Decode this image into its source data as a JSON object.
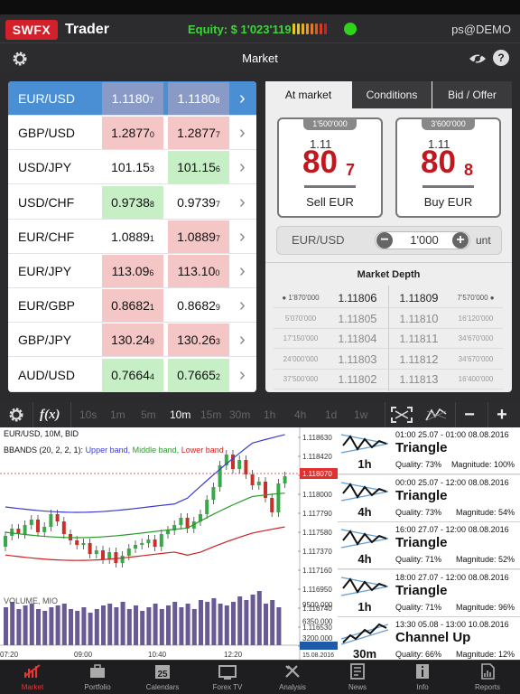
{
  "header": {
    "logo": "SWFX",
    "product": "Trader",
    "equity": "Equity: $ 1'023'119",
    "user": "ps@DEMO"
  },
  "nav": {
    "title": "Market"
  },
  "watchlist": [
    {
      "symbol": "EUR/USD",
      "bid": "1.1180",
      "bid_pip": "7",
      "ask": "1.1180",
      "ask_pip": "8",
      "state": "selected"
    },
    {
      "symbol": "GBP/USD",
      "bid": "1.2877",
      "bid_pip": "0",
      "ask": "1.2877",
      "ask_pip": "7",
      "state": "down"
    },
    {
      "symbol": "USD/JPY",
      "bid": "101.15",
      "bid_pip": "3",
      "ask": "101.15",
      "ask_pip": "6",
      "state": "up-ask"
    },
    {
      "symbol": "USD/CHF",
      "bid": "0.9738",
      "bid_pip": "8",
      "ask": "0.9739",
      "ask_pip": "7",
      "state": "up-bid"
    },
    {
      "symbol": "EUR/CHF",
      "bid": "1.0889",
      "bid_pip": "1",
      "ask": "1.0889",
      "ask_pip": "7",
      "state": "down-ask"
    },
    {
      "symbol": "EUR/JPY",
      "bid": "113.09",
      "bid_pip": "6",
      "ask": "113.10",
      "ask_pip": "0",
      "state": "down"
    },
    {
      "symbol": "EUR/GBP",
      "bid": "0.8682",
      "bid_pip": "1",
      "ask": "0.8682",
      "ask_pip": "9",
      "state": "down-bid"
    },
    {
      "symbol": "GBP/JPY",
      "bid": "130.24",
      "bid_pip": "9",
      "ask": "130.26",
      "ask_pip": "3",
      "state": "down"
    },
    {
      "symbol": "AUD/USD",
      "bid": "0.7664",
      "bid_pip": "4",
      "ask": "0.7665",
      "ask_pip": "2",
      "state": "up"
    }
  ],
  "order": {
    "tabs": [
      "At market",
      "Conditions",
      "Bid / Offer"
    ],
    "sell": {
      "amount": "1'500'000",
      "prefix": "1.11",
      "big": "80",
      "pip": "7",
      "label": "Sell EUR"
    },
    "buy": {
      "amount": "3'600'000",
      "prefix": "1.11",
      "big": "80",
      "pip": "8",
      "label": "Buy EUR"
    },
    "instrument": "EUR/USD",
    "quantity": "1'000",
    "unit": "unt"
  },
  "market_depth": {
    "title": "Market Depth",
    "rows": [
      {
        "bid_vol": "1'870'000",
        "bid": "1.1180",
        "bid_pip": "6",
        "ask": "1.1180",
        "ask_pip": "9",
        "ask_vol": "7'570'000"
      },
      {
        "bid_vol": "5'070'000",
        "bid": "1.1180",
        "bid_pip": "5",
        "ask": "1.1181",
        "ask_pip": "0",
        "ask_vol": "16'120'000"
      },
      {
        "bid_vol": "17'150'000",
        "bid": "1.1180",
        "bid_pip": "4",
        "ask": "1.1181",
        "ask_pip": "1",
        "ask_vol": "34'670'000"
      },
      {
        "bid_vol": "24'000'000",
        "bid": "1.1180",
        "bid_pip": "3",
        "ask": "1.1181",
        "ask_pip": "2",
        "ask_vol": "34'670'000"
      },
      {
        "bid_vol": "37'500'000",
        "bid": "1.1180",
        "bid_pip": "2",
        "ask": "1.1181",
        "ask_pip": "3",
        "ask_vol": "16'400'000"
      }
    ]
  },
  "chart_toolbar": {
    "fx": "f(x)",
    "timeframes": [
      "10s",
      "1m",
      "5m",
      "10m",
      "15m",
      "30m",
      "1h",
      "4h",
      "1d",
      "1w"
    ],
    "active": "10m"
  },
  "chart": {
    "title": "EUR/USD, 10M, BID",
    "indicator": "BBANDS (20, 2, 2, 1):",
    "upper": "Upper band,",
    "middle": "Middle band,",
    "lower": "Lower band",
    "volume_label": "VOLUME, MIO",
    "price_labels": [
      "1.118630",
      "1.118420",
      "1.118210",
      "1.118000",
      "1.117790",
      "1.117580",
      "1.117370",
      "1.117160",
      "1.116950",
      "1.116740",
      "1.116530",
      "1.116320"
    ],
    "current_price": "1.118070",
    "vol_labels": [
      "9500.000",
      "6350.000",
      "3200.000"
    ],
    "time_labels": [
      "07:20",
      "09:00",
      "10:40",
      "12:20"
    ],
    "date_label": "15.08.2016"
  },
  "patterns": [
    {
      "tf": "1h",
      "time": "01:00 25.07 - 01:00 08.08.2016",
      "name": "Triangle",
      "quality": "Quality: 73%",
      "magnitude": "Magnitude: 100%"
    },
    {
      "tf": "4h",
      "time": "00:00 25.07 - 12:00 08.08.2016",
      "name": "Triangle",
      "quality": "Quality: 73%",
      "magnitude": "Magnitude: 54%"
    },
    {
      "tf": "4h",
      "time": "16:00 27.07 - 12:00 08.08.2016",
      "name": "Triangle",
      "quality": "Quality: 71%",
      "magnitude": "Magnitude: 52%"
    },
    {
      "tf": "1h",
      "time": "18:00 27.07 - 12:00 08.08.2016",
      "name": "Triangle",
      "quality": "Quality: 71%",
      "magnitude": "Magnitude: 96%"
    },
    {
      "tf": "30m",
      "time": "13:30 05.08 - 13:00 10.08.2016",
      "name": "Channel Up",
      "quality": "Quality: 66%",
      "magnitude": "Magnitude: 12%"
    }
  ],
  "tabbar": [
    "Market",
    "Portfolio",
    "Calendars",
    "Forex TV",
    "Analysis",
    "News",
    "Info",
    "Reports"
  ],
  "calendar_day": "25",
  "colors": {
    "accent": "#d4202a",
    "equity": "#3fd43a",
    "selected": "#4a8ed4",
    "up": "#c6efc6",
    "down": "#f5c6c6",
    "upper_band": "#3a3ad0",
    "middle_band": "#2a9a2a",
    "lower_band": "#d02020"
  }
}
